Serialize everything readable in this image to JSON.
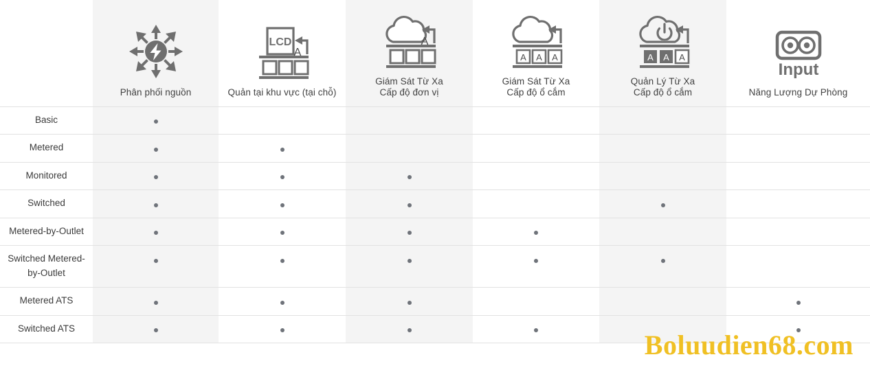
{
  "watermark": "Boluudien68.com",
  "accent_colors": {
    "watermark_gold": "#f0c024",
    "icon_gray": "#6f6f6f",
    "dot_gray": "#6f737a",
    "shaded_column": "#f4f4f4",
    "row_divider": "#e2e2e2"
  },
  "columns": [
    {
      "key": "power_distribution",
      "label": "Phân phối nguồn",
      "icon": "power-distribution-icon",
      "shaded": true
    },
    {
      "key": "local_management",
      "label": "Quản tại khu vực (tại chỗ)",
      "icon": "lcd-local-management-icon",
      "shaded": false
    },
    {
      "key": "remote_monitor_unit",
      "label": "Giám Sát Từ Xa\nCấp độ đơn vị",
      "icon": "cloud-monitor-unit-icon",
      "shaded": true
    },
    {
      "key": "remote_monitor_outlet",
      "label": "Giám Sát Từ Xa\nCấp độ ổ cắm",
      "icon": "cloud-monitor-outlet-icon",
      "shaded": false
    },
    {
      "key": "remote_manage_outlet",
      "label": "Quản Lý Từ Xa\nCấp độ ổ cắm",
      "icon": "cloud-power-control-outlet-icon",
      "shaded": true
    },
    {
      "key": "backup_power",
      "label": "Năng Lượng Dự Phòng",
      "icon": "input-outlets-icon",
      "icon_text": "Input",
      "shaded": false
    }
  ],
  "rows": [
    {
      "label": "Basic",
      "cells": [
        true,
        false,
        false,
        false,
        false,
        false
      ]
    },
    {
      "label": "Metered",
      "cells": [
        true,
        true,
        false,
        false,
        false,
        false
      ]
    },
    {
      "label": "Monitored",
      "cells": [
        true,
        true,
        true,
        false,
        false,
        false
      ]
    },
    {
      "label": "Switched",
      "cells": [
        true,
        true,
        true,
        false,
        true,
        false
      ]
    },
    {
      "label": "Metered-by-Outlet",
      "cells": [
        true,
        true,
        true,
        true,
        false,
        false
      ]
    },
    {
      "label": "Switched Metered-by-Outlet",
      "cells": [
        true,
        true,
        true,
        true,
        true,
        false
      ]
    },
    {
      "label": "Metered ATS",
      "cells": [
        true,
        true,
        true,
        false,
        false,
        true
      ]
    },
    {
      "label": "Switched ATS",
      "cells": [
        true,
        true,
        true,
        true,
        false,
        true
      ]
    }
  ]
}
